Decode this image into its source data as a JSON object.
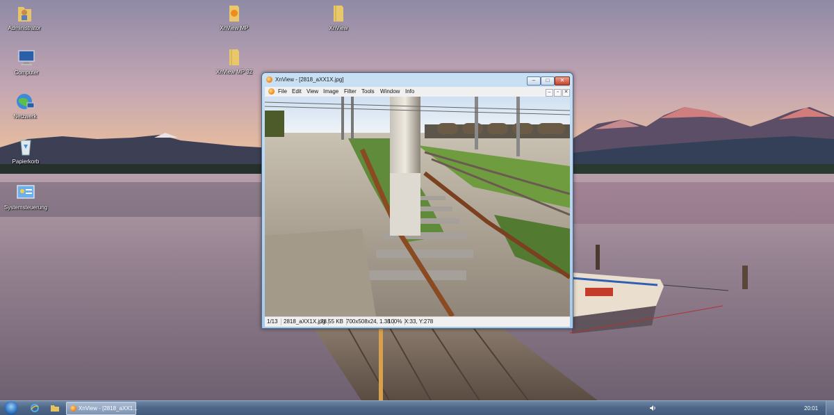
{
  "desktop": {
    "icons": [
      {
        "label": "Administrator",
        "icon": "user-folder-icon"
      },
      {
        "label": "Computer",
        "icon": "computer-icon"
      },
      {
        "label": "Netzwerk",
        "icon": "network-globe-icon"
      },
      {
        "label": "Papierkorb",
        "icon": "recycle-bin-icon"
      },
      {
        "label": "Systemsteuerung",
        "icon": "control-panel-icon"
      },
      {
        "label": "XnView MP",
        "icon": "xnview-mp-folder-icon"
      },
      {
        "label": "XnView MP 32",
        "icon": "folder-icon"
      },
      {
        "label": "XnView",
        "icon": "folder-icon"
      }
    ]
  },
  "window": {
    "title": "XnView - [2818_aXX1X.jpg]",
    "controls": {
      "minimize": "‒",
      "maximize": "□",
      "close": "✕"
    },
    "menu": [
      "File",
      "Edit",
      "View",
      "Image",
      "Filter",
      "Tools",
      "Window",
      "Info"
    ],
    "mdi_controls": {
      "minimize": "‒",
      "restore": "▫",
      "close": "✕"
    },
    "status": {
      "position": "1/13",
      "filename": "2818_aXX1X.jpg",
      "filesize": "78.55 KB",
      "dimensions": "700x508x24, 1.38",
      "zoom": "100%",
      "cursor": "X:33, Y:278"
    }
  },
  "taskbar": {
    "task_label": "XnView - [2818_aXX1...",
    "clock": "20:01"
  },
  "colors": {
    "sky_top": "#9d90a8",
    "sky_horizon": "#f3bf95",
    "water": "#8e7f8c",
    "taskbar": "#4f6889"
  }
}
